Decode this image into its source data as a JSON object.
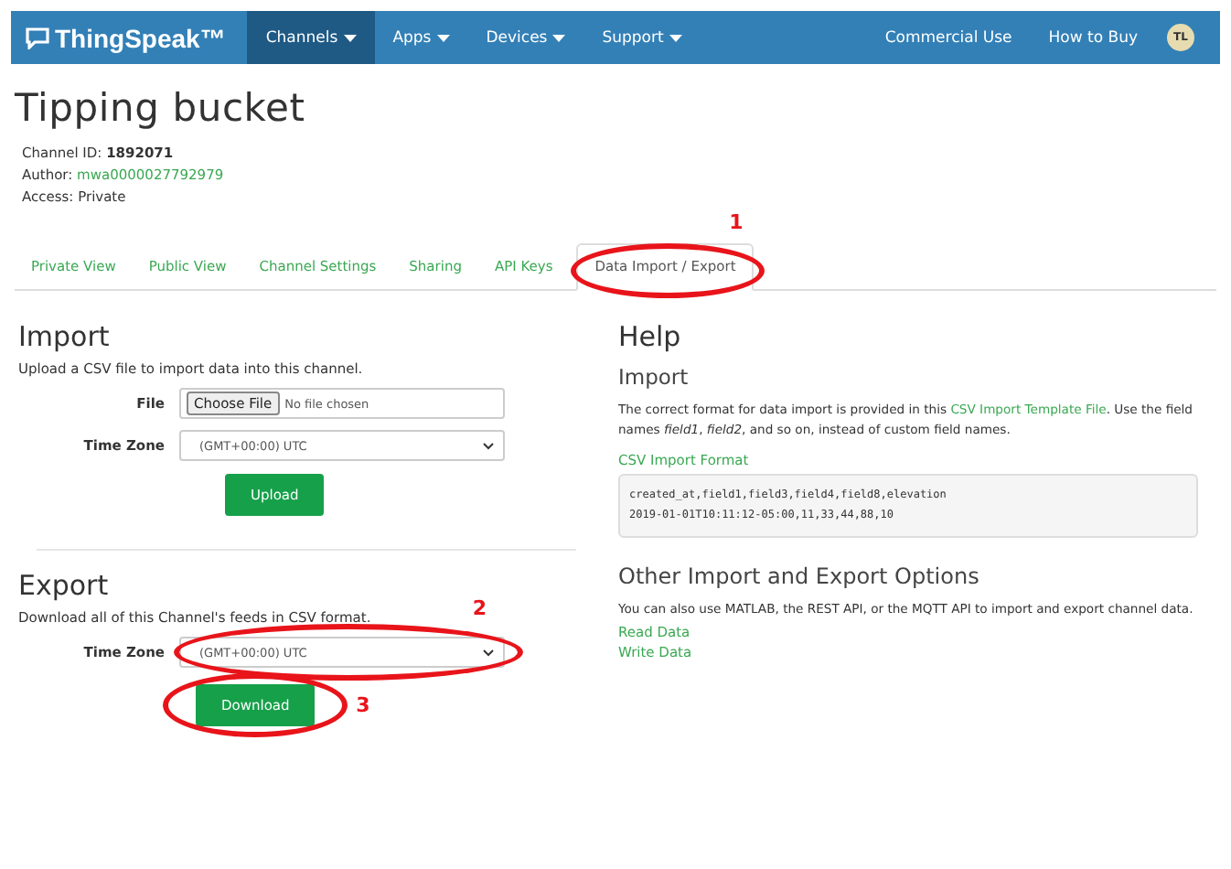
{
  "navbar": {
    "brand": "ThingSpeak™",
    "menus": [
      {
        "label": "Channels",
        "selected": true
      },
      {
        "label": "Apps",
        "selected": false
      },
      {
        "label": "Devices",
        "selected": false
      },
      {
        "label": "Support",
        "selected": false
      }
    ],
    "links": [
      "Commercial Use",
      "How to Buy"
    ],
    "avatar": "TL"
  },
  "title": "Tipping bucket",
  "info": [
    {
      "label": "Channel ID:",
      "value": "1892071",
      "kind": "bold"
    },
    {
      "label": "Author:",
      "value": "mwa0000027792979",
      "kind": "link"
    },
    {
      "label": "Access:",
      "value": "Private",
      "kind": "plain"
    }
  ],
  "tabs": [
    {
      "label": "Private View",
      "selected": false
    },
    {
      "label": "Public View",
      "selected": false
    },
    {
      "label": "Channel Settings",
      "selected": false
    },
    {
      "label": "Sharing",
      "selected": false
    },
    {
      "label": "API Keys",
      "selected": false
    },
    {
      "label": "Data Import / Export",
      "selected": true,
      "annotation": "1"
    }
  ],
  "import": {
    "heading": "Import",
    "description": "Upload a CSV file to import data into this channel.",
    "file_label": "File",
    "file_button": "Choose File",
    "file_status": "No file chosen",
    "timezone_label": "Time Zone",
    "timezone": "(GMT+00:00) UTC",
    "button": "Upload"
  },
  "export": {
    "heading": "Export",
    "description": "Download all of this Channel's feeds in CSV format.",
    "timezone_label": "Time Zone",
    "timezone": "(GMT+00:00) UTC",
    "timezone_annotation": "2",
    "button": "Download",
    "button_annotation": "3"
  },
  "help": {
    "heading": "Help",
    "import_heading": "Import",
    "text_before": "The correct format for data import is provided in this ",
    "template_link": "CSV Import Template File",
    "text_after": ". Use the field names *field1*, *field2*, and so on, instead of custom field names.",
    "format_heading": "CSV Import Format",
    "code": [
      "created_at,field1,field3,field4,field8,elevation",
      "2019-01-01T10:11:12-05:00,11,33,44,88,10"
    ],
    "other_heading": "Other Import and Export Options",
    "other_text": "You can also use MATLAB, the REST API, or the MQTT API to import and export channel data.",
    "links": [
      "Read Data",
      "Write Data"
    ]
  }
}
